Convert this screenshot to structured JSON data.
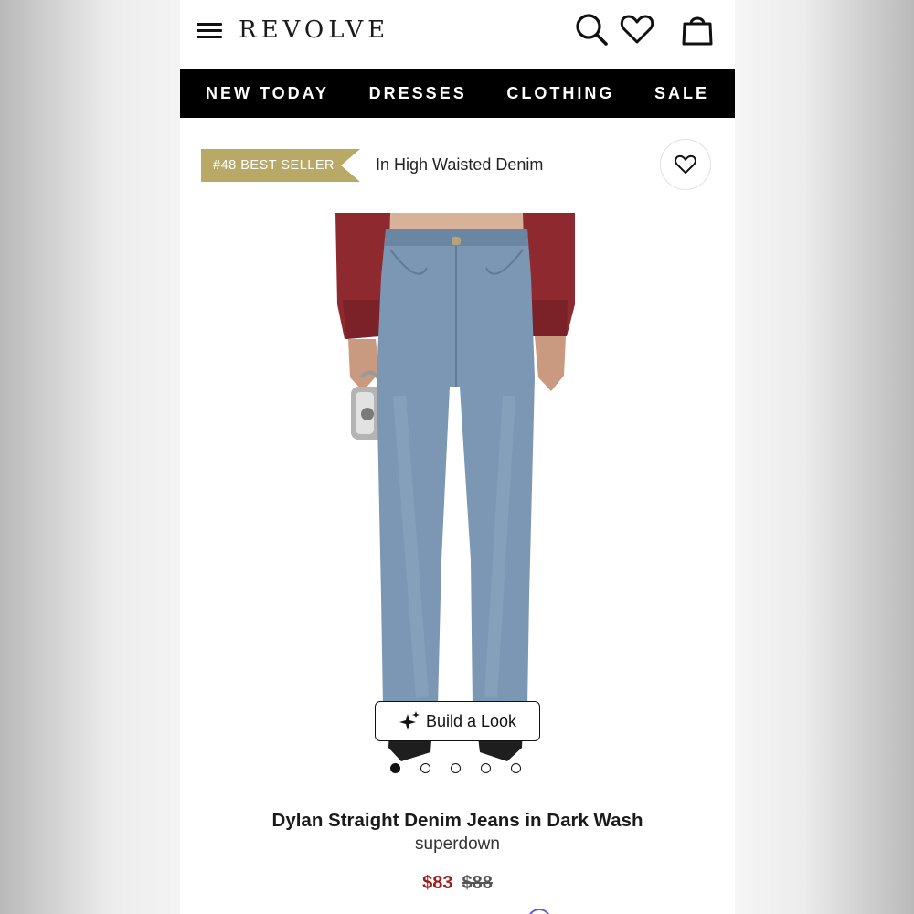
{
  "header": {
    "logo": "REVOLVE",
    "icons": [
      "menu-icon",
      "search-icon",
      "heart-icon",
      "bag-icon"
    ]
  },
  "nav": {
    "items": [
      "NEW TODAY",
      "DRESSES",
      "CLOTHING",
      "SALE"
    ]
  },
  "bestseller": {
    "badge": "#48 BEST SELLER",
    "category": "In High Waisted Denim",
    "badge_color": "#b8a967"
  },
  "gallery": {
    "build_a_look_label": "Build a Look",
    "total_images": 5,
    "active_index": 0
  },
  "product": {
    "title": "Dylan Straight Denim Jeans in Dark Wash",
    "brand": "superdown",
    "sale_price": "$83",
    "original_price": "$88",
    "sale_color": "#9b1b1b"
  }
}
